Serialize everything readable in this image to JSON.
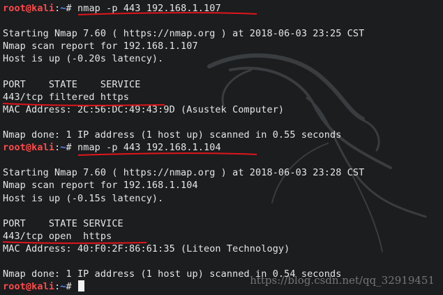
{
  "terminal": {
    "prompt": {
      "user_host": "root@kali",
      "separator": ":",
      "path": "~",
      "symbol": "#"
    },
    "lines": [
      {
        "type": "prompt",
        "command": "nmap -p 443 192.168.1.107"
      },
      {
        "type": "blank",
        "text": ""
      },
      {
        "type": "output",
        "text": "Starting Nmap 7.60 ( https://nmap.org ) at 2018-06-03 23:25 CST"
      },
      {
        "type": "output",
        "text": "Nmap scan report for 192.168.1.107"
      },
      {
        "type": "output",
        "text": "Host is up (-0.20s latency)."
      },
      {
        "type": "blank",
        "text": ""
      },
      {
        "type": "output",
        "text": "PORT    STATE    SERVICE"
      },
      {
        "type": "output",
        "text": "443/tcp filtered https"
      },
      {
        "type": "output",
        "text": "MAC Address: 2C:56:DC:49:43:9D (Asustek Computer)"
      },
      {
        "type": "blank",
        "text": ""
      },
      {
        "type": "output",
        "text": "Nmap done: 1 IP address (1 host up) scanned in 0.55 seconds"
      },
      {
        "type": "prompt",
        "command": "nmap -p 443 192.168.1.104"
      },
      {
        "type": "blank",
        "text": ""
      },
      {
        "type": "output",
        "text": "Starting Nmap 7.60 ( https://nmap.org ) at 2018-06-03 23:28 CST"
      },
      {
        "type": "output",
        "text": "Nmap scan report for 192.168.1.104"
      },
      {
        "type": "output",
        "text": "Host is up (-0.15s latency)."
      },
      {
        "type": "blank",
        "text": ""
      },
      {
        "type": "output",
        "text": "PORT    STATE SERVICE"
      },
      {
        "type": "output",
        "text": "443/tcp open  https"
      },
      {
        "type": "output",
        "text": "MAC Address: 40:F0:2F:86:61:35 (Liteon Technology)"
      },
      {
        "type": "blank",
        "text": ""
      },
      {
        "type": "output",
        "text": "Nmap done: 1 IP address (1 host up) scanned in 0.54 seconds"
      },
      {
        "type": "prompt",
        "command": "",
        "cursor": true
      }
    ]
  },
  "watermark": {
    "text": "https://blog.csdn.net/qq_32919451"
  },
  "colors": {
    "background": "#1b1d1f",
    "text": "#e6e6e6",
    "prompt_user": "#ff4a4a",
    "prompt_path": "#5a8cff",
    "annotation_underline": "#e0161b"
  },
  "icons": {
    "background_art": "kali-dragon-icon",
    "cursor": "block-cursor-icon"
  }
}
